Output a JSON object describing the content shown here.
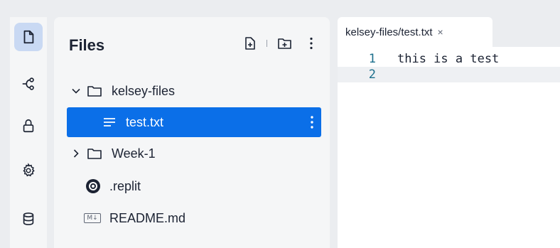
{
  "sidebar_rail": {
    "items": [
      {
        "icon": "files-icon",
        "active": true
      },
      {
        "icon": "git-icon"
      },
      {
        "icon": "lock-icon"
      },
      {
        "icon": "gear-icon"
      },
      {
        "icon": "database-icon"
      }
    ]
  },
  "files_panel": {
    "title": "Files",
    "tree": [
      {
        "label": "kelsey-files",
        "type": "folder",
        "expanded": true
      },
      {
        "label": "test.txt",
        "type": "file",
        "selected": true
      },
      {
        "label": "Week-1",
        "type": "folder",
        "expanded": false
      },
      {
        "label": ".replit",
        "type": "config"
      },
      {
        "label": "README.md",
        "type": "markdown",
        "badge": "M↓"
      }
    ]
  },
  "editor": {
    "tab_label": "kelsey-files/test.txt",
    "tab_close": "×",
    "lines": [
      {
        "number": "1",
        "text": "this is a test"
      },
      {
        "number": "2",
        "text": ""
      }
    ]
  },
  "colors": {
    "accent": "#0b6fe8",
    "rail_active": "#c9d9f3",
    "line_number": "#1c6f8c"
  }
}
